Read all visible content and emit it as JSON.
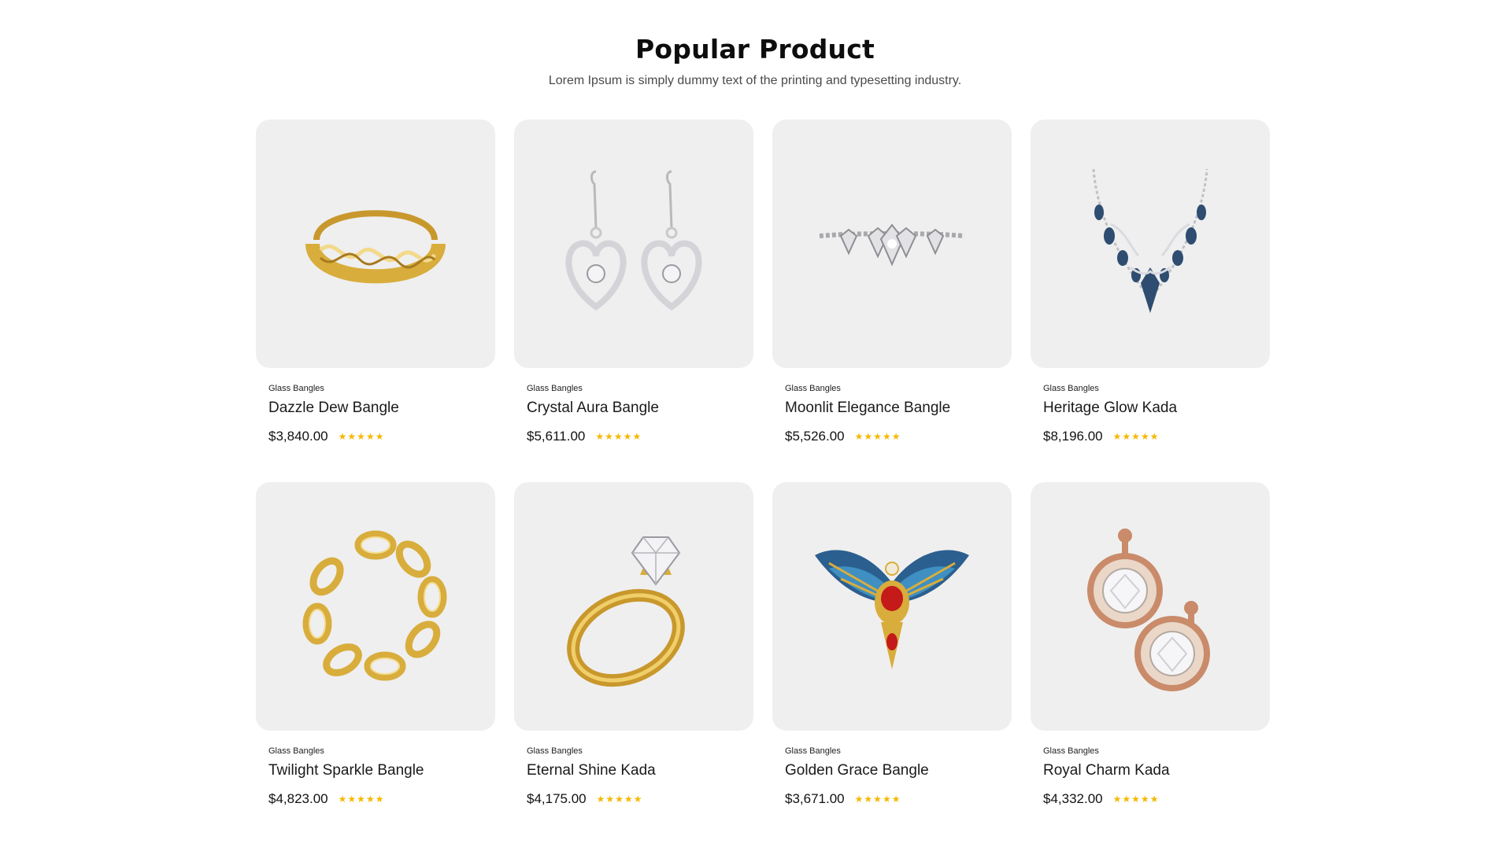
{
  "section": {
    "title": "Popular Product",
    "subtitle": "Lorem Ipsum is simply dummy text of the printing and typesetting industry."
  },
  "products": [
    {
      "category": "Glass Bangles",
      "name": "Dazzle Dew Bangle",
      "price": "$3,840.00",
      "rating": 5,
      "image_icon": "gold-braided-cuff-icon"
    },
    {
      "category": "Glass Bangles",
      "name": "Crystal Aura Bangle",
      "price": "$5,611.00",
      "rating": 5,
      "image_icon": "silver-heart-earrings-icon"
    },
    {
      "category": "Glass Bangles",
      "name": "Moonlit Elegance Bangle",
      "price": "$5,526.00",
      "rating": 5,
      "image_icon": "diamond-bracelet-icon"
    },
    {
      "category": "Glass Bangles",
      "name": "Heritage Glow Kada",
      "price": "$8,196.00",
      "rating": 5,
      "image_icon": "sapphire-necklace-icon"
    },
    {
      "category": "Glass Bangles",
      "name": "Twilight Sparkle Bangle",
      "price": "$4,823.00",
      "rating": 5,
      "image_icon": "gold-chain-bracelet-icon"
    },
    {
      "category": "Glass Bangles",
      "name": "Eternal Shine Kada",
      "price": "$4,175.00",
      "rating": 5,
      "image_icon": "gold-diamond-ring-icon"
    },
    {
      "category": "Glass Bangles",
      "name": "Golden Grace Bangle",
      "price": "$3,671.00",
      "rating": 5,
      "image_icon": "winged-brooch-icon"
    },
    {
      "category": "Glass Bangles",
      "name": "Royal Charm Kada",
      "price": "$4,332.00",
      "rating": 5,
      "image_icon": "rose-gold-stud-earrings-icon"
    }
  ],
  "colors": {
    "card_background": "#efefef",
    "star": "#f5b800",
    "gold": "#d8ad3c",
    "silver": "#c9c9cc",
    "sapphire": "#2e4d70",
    "ruby": "#c41a1a",
    "rose_gold": "#c98b6a"
  }
}
